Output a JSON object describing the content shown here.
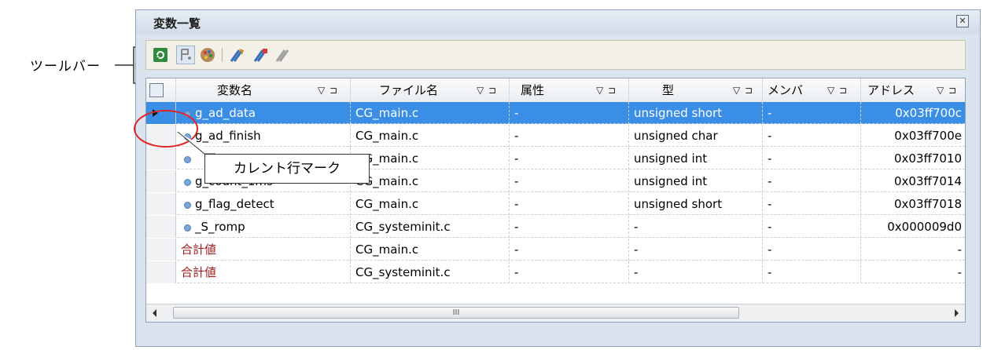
{
  "annotations": {
    "toolbar_label": "ツールバー",
    "current_row_mark_label": "カレント行マーク"
  },
  "window": {
    "title": "変数一覧",
    "close_glyph": "✕"
  },
  "toolbar": {
    "buttons": [
      {
        "icon": "refresh-icon",
        "color": "#2e8b3a"
      },
      {
        "icon": "pointer-pin-icon",
        "color": "#8a8a8a"
      },
      {
        "icon": "palette-icon",
        "color": "#8b3a8e"
      },
      {
        "icon": "bookmark-add-icon",
        "color": "#3a6fb8"
      },
      {
        "icon": "bookmark-edit-icon",
        "color": "#3a6fb8"
      },
      {
        "icon": "bookmark-remove-icon",
        "color": "#a0a0a0"
      }
    ]
  },
  "grid": {
    "columns": [
      {
        "label": "変数名",
        "filter": "▽ ⊐"
      },
      {
        "label": "ファイル名",
        "filter": "▽ ⊐"
      },
      {
        "label": "属性",
        "filter": "▽ ⊐"
      },
      {
        "label": "型",
        "filter": "▽ ⊐"
      },
      {
        "label": "メンバ",
        "filter": "▽ ⊐"
      },
      {
        "label": "アドレス",
        "filter": "▽ ⊐"
      }
    ],
    "rows": [
      {
        "name": "g_ad_data",
        "file": "CG_main.c",
        "attr": "-",
        "type": "unsigned short",
        "member": "-",
        "address": "0x03ff700c",
        "selected": true,
        "current": true,
        "total": false
      },
      {
        "name": "g_ad_finish",
        "file": "CG_main.c",
        "attr": "-",
        "type": "unsigned char",
        "member": "-",
        "address": "0x03ff700e",
        "selected": false,
        "current": false,
        "total": false
      },
      {
        "name": "",
        "file": "CG_main.c",
        "attr": "-",
        "type": "unsigned int",
        "member": "-",
        "address": "0x03ff7010",
        "selected": false,
        "current": false,
        "total": false
      },
      {
        "name": "g_count_1ms",
        "file": "CG_main.c",
        "attr": "-",
        "type": "unsigned int",
        "member": "-",
        "address": "0x03ff7014",
        "selected": false,
        "current": false,
        "total": false
      },
      {
        "name": "g_flag_detect",
        "file": "CG_main.c",
        "attr": "-",
        "type": "unsigned short",
        "member": "-",
        "address": "0x03ff7018",
        "selected": false,
        "current": false,
        "total": false
      },
      {
        "name": "_S_romp",
        "file": "CG_systeminit.c",
        "attr": "-",
        "type": "-",
        "member": "-",
        "address": "0x000009d0",
        "selected": false,
        "current": false,
        "total": false
      },
      {
        "name": "合計値",
        "file": "CG_main.c",
        "attr": "-",
        "type": "-",
        "member": "-",
        "address": "-",
        "selected": false,
        "current": false,
        "total": true
      },
      {
        "name": "合計値",
        "file": "CG_systeminit.c",
        "attr": "-",
        "type": "-",
        "member": "-",
        "address": "-",
        "selected": false,
        "current": false,
        "total": true
      }
    ]
  },
  "scrollbar": {
    "thumb_grip": "III"
  },
  "colors": {
    "selection": "#3a8ee6",
    "total_text": "#a11b1b",
    "callout_ring": "#e32222"
  }
}
